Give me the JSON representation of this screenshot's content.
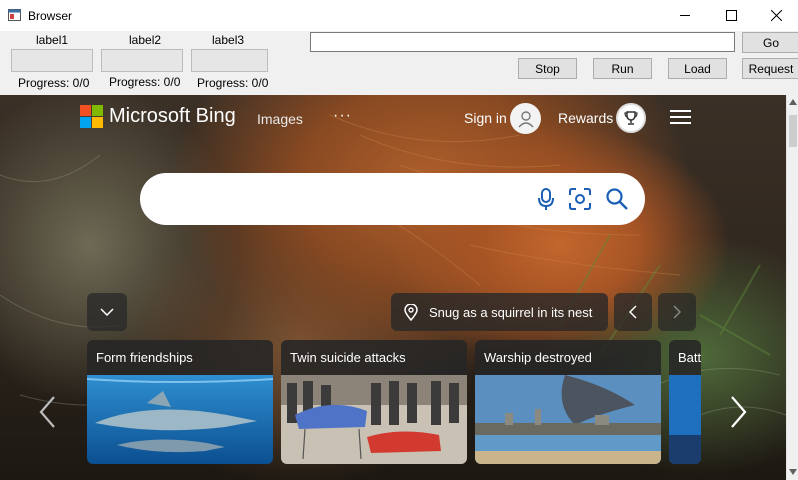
{
  "window": {
    "title": "Browser",
    "icon": "app-window-icon"
  },
  "toolbar": {
    "labels": [
      "label1",
      "label2",
      "label3"
    ],
    "progress": [
      {
        "text": "Progress: 0/0",
        "value": 0
      },
      {
        "text": "Progress: 0/0",
        "value": 0
      },
      {
        "text": "Progress: 0/0",
        "value": 0
      }
    ],
    "url": {
      "value": "",
      "placeholder": ""
    },
    "buttons": {
      "go": "Go",
      "stop": "Stop",
      "run": "Run",
      "load": "Load",
      "request": "Request"
    }
  },
  "bing": {
    "brand": "Microsoft Bing",
    "nav_images": "Images",
    "nav_more": "···",
    "sign_in": "Sign in",
    "rewards": "Rewards",
    "search_placeholder": "",
    "image_caption": "Snug as a squirrel in its nest",
    "cards": [
      {
        "title": "Form friendships"
      },
      {
        "title": "Twin suicide attacks"
      },
      {
        "title": "Warship destroyed"
      },
      {
        "title": "Batt"
      }
    ]
  },
  "colors": {
    "accent": "#0078d4",
    "icon_blue": "#1a5fb4",
    "logo": [
      "#f25022",
      "#7fba00",
      "#00a4ef",
      "#ffb900"
    ]
  }
}
